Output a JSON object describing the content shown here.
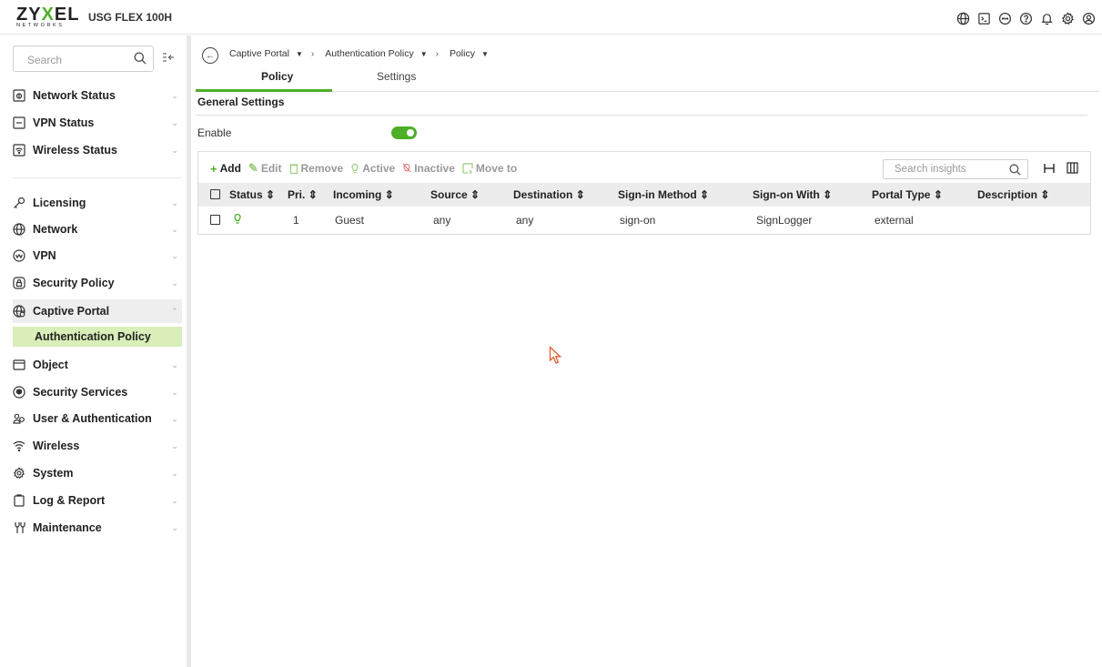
{
  "brand": {
    "logo_main": "ZYXEL",
    "logo_sub": "NETWORKS",
    "product": "USG FLEX 100H",
    "accent_color": "#4caf28"
  },
  "topbar_icons": [
    "globe-icon",
    "terminal-icon",
    "chat-icon",
    "help-icon",
    "bell-icon",
    "settings-icon",
    "account-icon"
  ],
  "sidebar": {
    "search_placeholder": "Search",
    "status_items": [
      {
        "label": "Network Status",
        "icon": "monitor-icon"
      },
      {
        "label": "VPN Status",
        "icon": "vpn-status-icon"
      },
      {
        "label": "Wireless Status",
        "icon": "wireless-status-icon"
      }
    ],
    "config_items": [
      {
        "label": "Licensing",
        "icon": "key-icon"
      },
      {
        "label": "Network",
        "icon": "globe-icon"
      },
      {
        "label": "VPN",
        "icon": "vpn-icon"
      },
      {
        "label": "Security Policy",
        "icon": "security-policy-icon"
      },
      {
        "label": "Captive Portal",
        "icon": "captive-portal-icon",
        "expanded": true
      },
      {
        "label": "Object",
        "icon": "object-icon"
      },
      {
        "label": "Security Services",
        "icon": "shield-icon"
      },
      {
        "label": "User & Authentication",
        "icon": "users-icon"
      },
      {
        "label": "Wireless",
        "icon": "wifi-icon"
      },
      {
        "label": "System",
        "icon": "gear-icon"
      },
      {
        "label": "Log & Report",
        "icon": "clipboard-icon"
      },
      {
        "label": "Maintenance",
        "icon": "wrench-icon"
      }
    ],
    "active_sub_item": "Authentication Policy"
  },
  "breadcrumb": [
    "Captive Portal",
    "Authentication Policy",
    "Policy"
  ],
  "tabs": [
    "Policy",
    "Settings"
  ],
  "general_settings": {
    "title": "General Settings",
    "enable_label": "Enable",
    "enabled": true
  },
  "toolbar": {
    "add": "Add",
    "edit": "Edit",
    "remove": "Remove",
    "active": "Active",
    "inactive": "Inactive",
    "move_to": "Move to",
    "search_placeholder": "Search insights"
  },
  "table": {
    "columns": [
      "Status",
      "Pri.",
      "Incoming",
      "Source",
      "Destination",
      "Sign-in Method",
      "Sign-on With",
      "Portal Type",
      "Description"
    ],
    "rows": [
      {
        "status": "active",
        "priority": "1",
        "incoming": "Guest",
        "source": "any",
        "destination": "any",
        "sign_in_method": "sign-on",
        "sign_on_with": "SignLogger",
        "portal_type": "external",
        "description": ""
      }
    ]
  }
}
